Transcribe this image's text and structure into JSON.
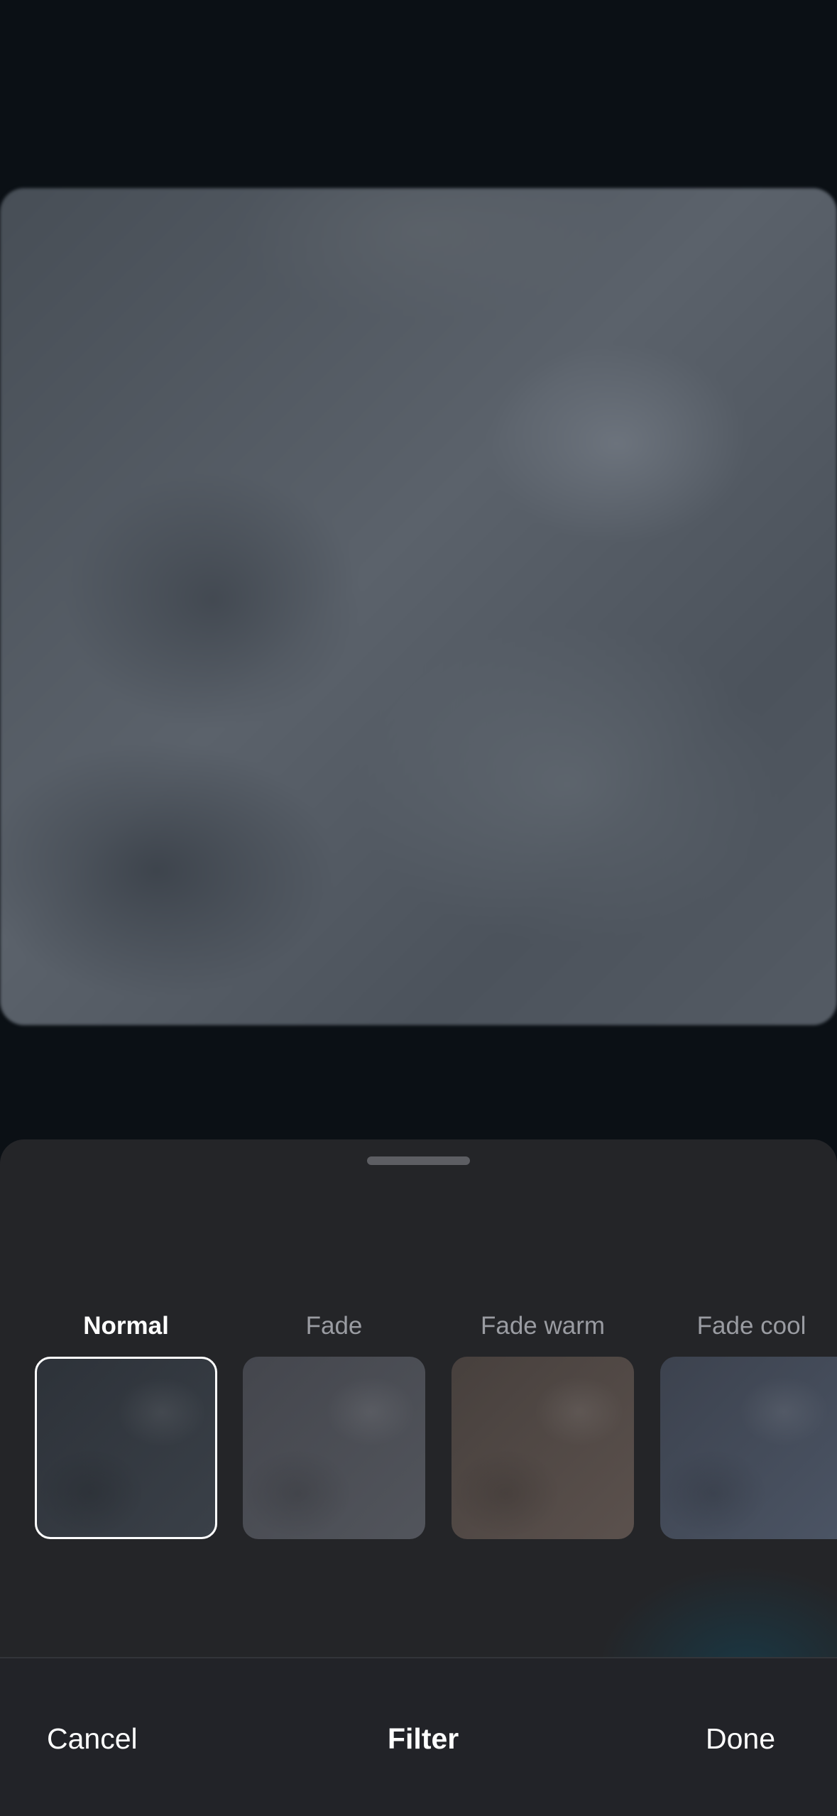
{
  "filters": [
    {
      "label": "Normal",
      "selected": true,
      "tint": [
        "#2d3239",
        "#3a4048"
      ]
    },
    {
      "label": "Fade",
      "selected": false,
      "tint": [
        "#44464d",
        "#52555c"
      ]
    },
    {
      "label": "Fade warm",
      "selected": false,
      "tint": [
        "#47403d",
        "#5b514d"
      ]
    },
    {
      "label": "Fade cool",
      "selected": false,
      "tint": [
        "#3c424e",
        "#4b5464"
      ]
    }
  ],
  "bottom_bar": {
    "cancel_label": "Cancel",
    "title": "Filter",
    "done_label": "Done"
  },
  "colors": {
    "background": "#0b1015",
    "sheet": "#242528",
    "selected_border": "#ffffff",
    "unselected_label": "#9a9ca2"
  }
}
